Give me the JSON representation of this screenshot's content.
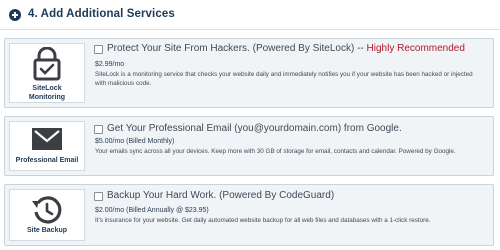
{
  "section": {
    "title": "4. Add Additional Services"
  },
  "services": [
    {
      "id": "sitelock",
      "icon_name": "lock-icon",
      "icon_label": "SiteLock Monitoring",
      "title_main": "Protect Your Site From Hackers. (Powered By SiteLock) -- ",
      "title_highlight": "Highly Recommended",
      "price": "$2.99/mo",
      "description": "SiteLock is a monitoring service that checks your website daily and immediately notifies you if your website has been hacked or injected with malicious code.",
      "checked": false
    },
    {
      "id": "email",
      "icon_name": "envelope-icon",
      "icon_label": "Professional Email",
      "title_main": "Get Your Professional Email (you@yourdomain.com) from Google.",
      "price": "$5.00/mo (Billed Monthly)",
      "description": "Your emails sync across all your devices. Keep more with 30 GB of storage for email, contacts and calendar. Powered by Google.",
      "checked": false
    },
    {
      "id": "backup",
      "icon_name": "backup-clock-icon",
      "icon_label": "Site Backup",
      "title_main": "Backup Your Hard Work. (Powered By CodeGuard)",
      "price": "$2.00/mo (Billed Annually @ $23.95)",
      "description": "It's insurance for your website. Get daily automated website backup for all web files and databases with a 1-click restore.",
      "checked": false
    }
  ],
  "colors": {
    "heading": "#1c3a57",
    "highlight": "#b5162b",
    "card_bg": "#f1f4f7",
    "card_border": "#c9d3dc"
  }
}
